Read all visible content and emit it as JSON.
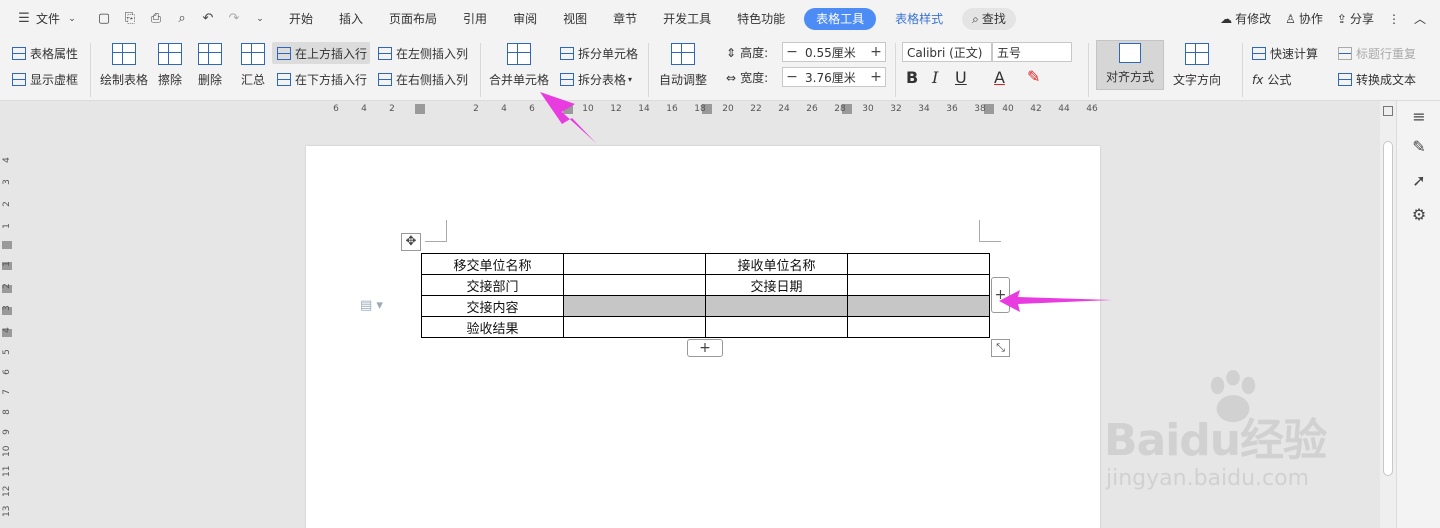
{
  "menubar": {
    "file_label": "文件",
    "tabs": [
      "开始",
      "插入",
      "页面布局",
      "引用",
      "审阅",
      "视图",
      "章节",
      "开发工具",
      "特色功能"
    ],
    "active_tab": "表格工具",
    "accent_tab": "表格样式",
    "search_label": "查找",
    "right_items": {
      "has_changes": "有修改",
      "collaborate": "协作",
      "share": "分享"
    }
  },
  "ribbon": {
    "table_properties": "表格属性",
    "show_gridlines": "显示虚框",
    "draw_table": "绘制表格",
    "erase": "擦除",
    "delete": "删除",
    "summary": "汇总",
    "insert_row_above": "在上方插入行",
    "insert_row_below": "在下方插入行",
    "insert_col_left": "在左侧插入列",
    "insert_col_right": "在右侧插入列",
    "merge_cells": "合并单元格",
    "split_cells": "拆分单元格",
    "split_table": "拆分表格",
    "auto_adjust": "自动调整",
    "height_label": "高度:",
    "height_value": "0.55厘米",
    "width_label": "宽度:",
    "width_value": "3.76厘米",
    "font_name": "Calibri (正文)",
    "font_size": "五号",
    "alignment": "对齐方式",
    "text_direction": "文字方向",
    "quick_calc": "快速计算",
    "title_row_repeat": "标题行重复",
    "formula": "公式",
    "convert_to_text": "转换成文本"
  },
  "ruler": {
    "h_ticks": [
      "6",
      "4",
      "2",
      "2",
      "4",
      "6",
      "8",
      "10",
      "12",
      "14",
      "16",
      "18",
      "20",
      "22",
      "24",
      "26",
      "28",
      "30",
      "32",
      "34",
      "36",
      "38",
      "40",
      "42",
      "44",
      "46"
    ],
    "v_ticks": [
      "4",
      "3",
      "2",
      "1",
      "1",
      "2",
      "3",
      "4",
      "5",
      "6",
      "7",
      "8",
      "9",
      "10",
      "11",
      "12",
      "13"
    ]
  },
  "document": {
    "table": [
      [
        "移交单位名称",
        "",
        "接收单位名称",
        ""
      ],
      [
        "交接部门",
        "",
        "交接日期",
        ""
      ],
      [
        "交接内容",
        "",
        "",
        ""
      ],
      [
        "验收结果",
        "",
        "",
        ""
      ]
    ]
  },
  "colors": {
    "active_tab_bg": "#4d8cf5",
    "accent_tab_text": "#3a73d4",
    "selected_cells": "#c6c6c6",
    "annotation_arrow": "#e83be0"
  },
  "watermark": {
    "logo": "Baidu经验",
    "url": "jingyan.baidu.com"
  }
}
